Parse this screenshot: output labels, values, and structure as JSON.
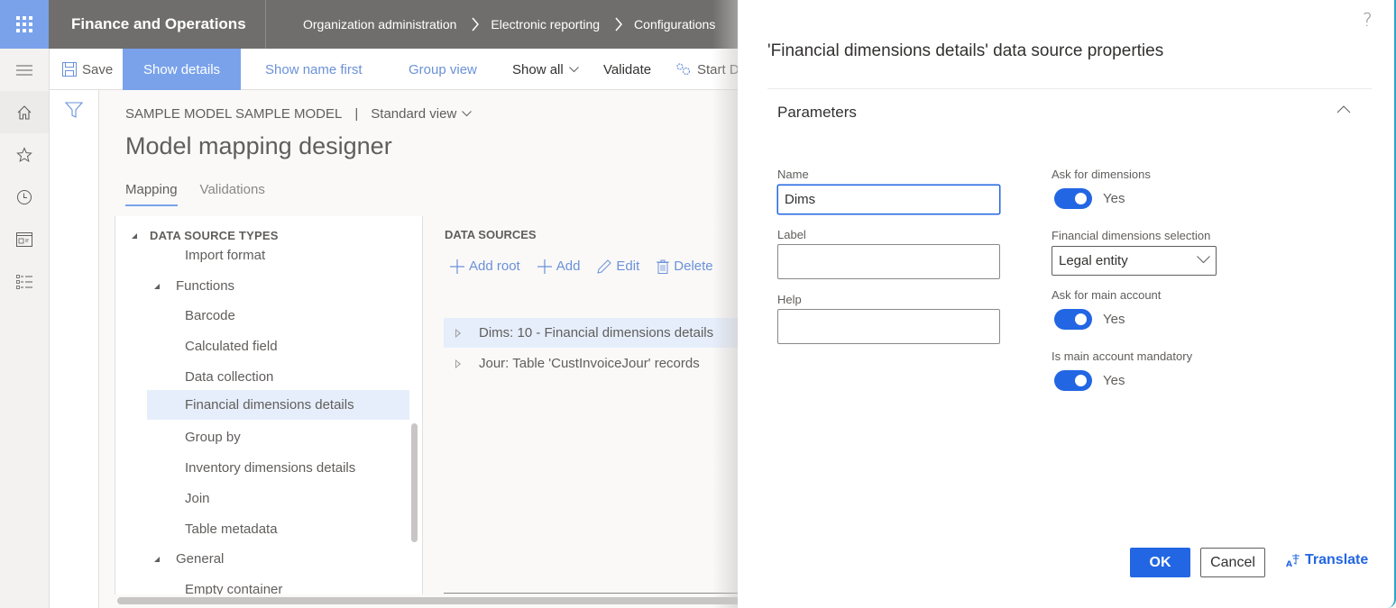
{
  "app": {
    "title": "Finance and Operations",
    "breadcrumb": [
      "Organization administration",
      "Electronic reporting",
      "Configurations"
    ]
  },
  "leftnav": {
    "items": [
      {
        "name": "menu",
        "icon": "hamburger-icon"
      },
      {
        "name": "home",
        "icon": "home-icon"
      },
      {
        "name": "favorites",
        "icon": "star-icon"
      },
      {
        "name": "recent",
        "icon": "clock-icon"
      },
      {
        "name": "workspaces",
        "icon": "workspace-icon"
      },
      {
        "name": "modules",
        "icon": "list-icon"
      }
    ]
  },
  "actionpane": {
    "save": "Save",
    "show_details": "Show details",
    "show_name_first": "Show name first",
    "group_view": "Group view",
    "show_all": "Show all",
    "validate": "Validate",
    "start_debugging": "Start D"
  },
  "page": {
    "caption": "SAMPLE MODEL SAMPLE MODEL",
    "caption_separator": "|",
    "view": "Standard view",
    "title": "Model mapping designer",
    "tabs": [
      {
        "label": "Mapping",
        "active": true
      },
      {
        "label": "Validations",
        "active": false
      }
    ]
  },
  "tree": {
    "root": "DATA SOURCE TYPES",
    "items": [
      {
        "label": "Import format",
        "type": "leaf"
      },
      {
        "label": "Functions",
        "type": "group"
      },
      {
        "label": "Barcode",
        "type": "leaf"
      },
      {
        "label": "Calculated field",
        "type": "leaf"
      },
      {
        "label": "Data collection",
        "type": "leaf"
      },
      {
        "label": "Financial dimensions details",
        "type": "leaf",
        "selected": true
      },
      {
        "label": "Group by",
        "type": "leaf"
      },
      {
        "label": "Inventory dimensions details",
        "type": "leaf"
      },
      {
        "label": "Join",
        "type": "leaf"
      },
      {
        "label": "Table metadata",
        "type": "leaf"
      },
      {
        "label": "General",
        "type": "group"
      },
      {
        "label": "Empty container",
        "type": "leaf"
      }
    ]
  },
  "datasources": {
    "title": "DATA SOURCES",
    "actions": {
      "add_root": "Add root",
      "add": "Add",
      "edit": "Edit",
      "delete": "Delete"
    },
    "rows": [
      {
        "label": "Dims: 10 - Financial dimensions details",
        "selected": true
      },
      {
        "label": "Jour: Table 'CustInvoiceJour' records",
        "selected": false
      }
    ]
  },
  "dialog": {
    "help": "?",
    "title": "'Financial dimensions details' data source properties",
    "section": "Parameters",
    "fields": {
      "name_label": "Name",
      "name_value": "Dims",
      "label_label": "Label",
      "label_value": "",
      "help_label": "Help",
      "help_value": ""
    },
    "options": {
      "ask_dimensions_label": "Ask for dimensions",
      "ask_dimensions_value": "Yes",
      "fin_dim_selection_label": "Financial dimensions selection",
      "fin_dim_selection_value": "Legal entity",
      "ask_main_account_label": "Ask for main account",
      "ask_main_account_value": "Yes",
      "main_account_mandatory_label": "Is main account mandatory",
      "main_account_mandatory_value": "Yes"
    },
    "buttons": {
      "ok": "OK",
      "cancel": "Cancel",
      "translate": "Translate"
    }
  },
  "colors": {
    "accent": "#79a2eb",
    "primary": "#2266e3",
    "topbar": "#6f6e6d",
    "dialog_border": "#2aa7c1"
  }
}
